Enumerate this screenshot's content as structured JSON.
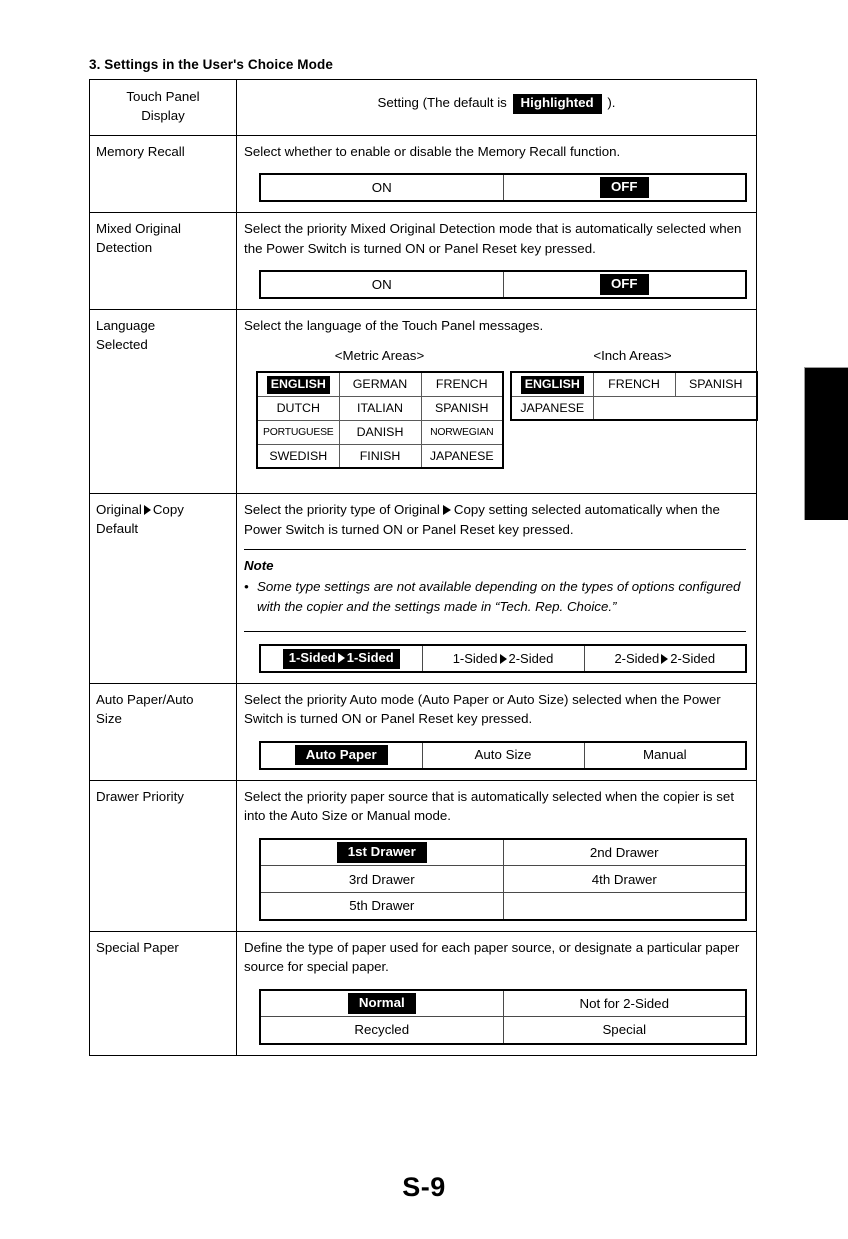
{
  "heading": "3. Settings in the User's Choice Mode",
  "footer": "S-9",
  "table": {
    "header": {
      "label_line1": "Touch Panel",
      "label_line2": "Display",
      "setting_prefix": "Setting (The default is",
      "highlighted_chip": "Highlighted",
      "setting_suffix": ")."
    },
    "rows": [
      {
        "label": "Memory Recall",
        "description": "Select whether to enable or disable the Memory Recall function.",
        "options": [
          "ON",
          "OFF"
        ],
        "selected": "OFF"
      },
      {
        "label_line1": "Mixed Original",
        "label_line2": "Detection",
        "description": "Select the priority Mixed Original Detection mode that is automatically selected when the Power Switch is turned ON or Panel Reset key pressed.",
        "options": [
          "ON",
          "OFF"
        ],
        "selected": "OFF"
      },
      {
        "label_line1": "Language",
        "label_line2": "Selected",
        "description": "Select the language of the Touch Panel messages.",
        "metric_heading": "<Metric Areas>",
        "inch_heading": "<Inch Areas>",
        "metric_languages": [
          [
            "ENGLISH",
            "GERMAN",
            "FRENCH"
          ],
          [
            "DUTCH",
            "ITALIAN",
            "SPANISH"
          ],
          [
            "PORTUGUESE",
            "DANISH",
            "NORWEGIAN"
          ],
          [
            "SWEDISH",
            "FINISH",
            "JAPANESE"
          ]
        ],
        "metric_selected": "ENGLISH",
        "inch_languages": [
          [
            "ENGLISH",
            "FRENCH",
            "SPANISH"
          ],
          [
            "JAPANESE",
            "",
            ""
          ]
        ],
        "inch_selected": "ENGLISH"
      },
      {
        "label_line1_a": "Original",
        "label_line1_b": "Copy",
        "label_line2": "Default",
        "desc_a": "Select the priority type of Original",
        "desc_b": "Copy setting selected automatically when the Power Switch is turned ON or Panel Reset key pressed.",
        "note_title": "Note",
        "note_bullet": "•",
        "note_text": "Some type settings are not available depending on the types of options configured with the copier and the settings made in “Tech. Rep. Choice.”",
        "options": [
          {
            "left": "1-Sided",
            "right": "1-Sided"
          },
          {
            "left": "1-Sided",
            "right": "2-Sided"
          },
          {
            "left": "2-Sided",
            "right": "2-Sided"
          }
        ],
        "selected_index": 0
      },
      {
        "label_line1": "Auto Paper/Auto",
        "label_line2": "Size",
        "description": "Select the priority Auto mode (Auto Paper or Auto Size) selected when the Power Switch is turned ON or Panel Reset key pressed.",
        "options": [
          "Auto Paper",
          "Auto Size",
          "Manual"
        ],
        "selected": "Auto Paper"
      },
      {
        "label": "Drawer Priority",
        "description": "Select the priority paper source that is automatically selected when the copier is set into the Auto Size or Manual mode.",
        "options_grid": [
          [
            "1st Drawer",
            "2nd Drawer"
          ],
          [
            "3rd Drawer",
            "4th Drawer"
          ],
          [
            "5th Drawer",
            ""
          ]
        ],
        "selected": "1st Drawer"
      },
      {
        "label": "Special Paper",
        "description": "Define the type of paper used for each paper source, or designate a particular paper source for special paper.",
        "options_grid": [
          [
            "Normal",
            "Not for 2-Sided"
          ],
          [
            "Recycled",
            "Special"
          ]
        ],
        "selected": "Normal"
      }
    ]
  }
}
